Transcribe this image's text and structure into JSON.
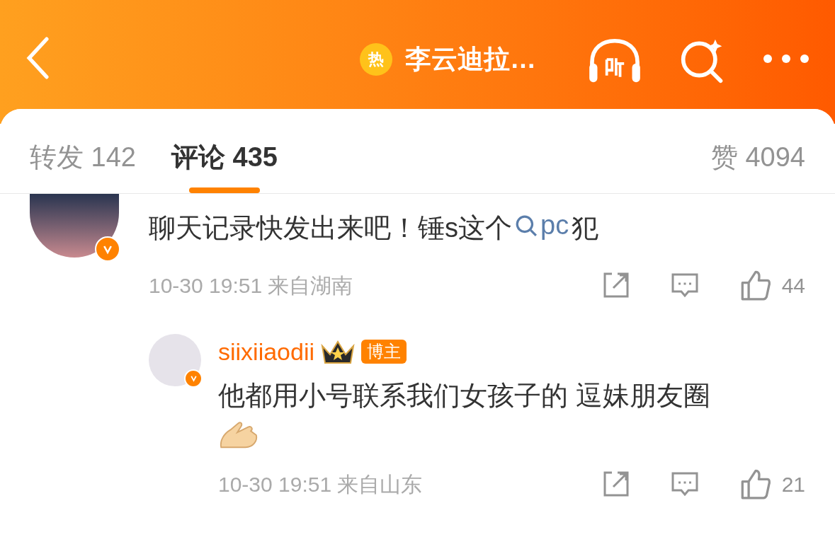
{
  "header": {
    "title": "李云迪拉…",
    "hot_badge": "热"
  },
  "tabs": [
    {
      "label": "转发 142",
      "selected": false
    },
    {
      "label": "评论 435",
      "selected": true
    },
    {
      "label": "赞 4094",
      "selected": false
    }
  ],
  "comments": [
    {
      "text": "聊天记录快发出来吧！锤s这个",
      "link": "pc",
      "text_after": "犯",
      "time": "10-30 19:51 来自湖南",
      "likes": "44",
      "verified": true
    }
  ],
  "replies": [
    {
      "username": "siixiiaodii",
      "badge": "博主",
      "text": "他都用小号联系我们女孩子的 逗妹朋友圈",
      "time": "10-30 19:51 来自山东",
      "likes": "21",
      "verified": true
    }
  ]
}
